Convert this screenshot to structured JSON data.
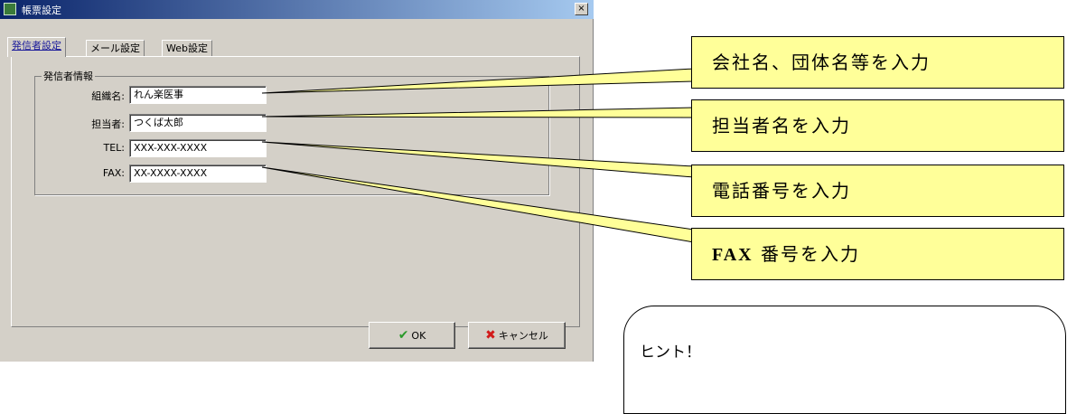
{
  "window": {
    "title": "帳票設定",
    "close_label": "×"
  },
  "tabs": [
    {
      "label": "発信者設定",
      "active": true
    },
    {
      "label": "メール設定",
      "active": false
    },
    {
      "label": "Web設定",
      "active": false
    }
  ],
  "group": {
    "title": "発信者情報"
  },
  "fields": [
    {
      "label": "組織名:",
      "value": "れん楽医事"
    },
    {
      "label": "担当者:",
      "value": "つくば太郎"
    },
    {
      "label": "TEL:",
      "value": "XXX-XXX-XXXX"
    },
    {
      "label": "FAX:",
      "value": "XX-XXXX-XXXX"
    }
  ],
  "buttons": {
    "ok_label": "OK",
    "cancel_label": "キャンセル"
  },
  "callouts": [
    {
      "text": "会社名、団体名等を入力"
    },
    {
      "text": "担当者名を入力"
    },
    {
      "text": "電話番号を入力"
    },
    {
      "text_prefix": "FAX",
      "text": " 番号を入力"
    }
  ],
  "hint": {
    "title": "ヒント！"
  },
  "colors": {
    "callout_fill": "#ffff99",
    "dialog_face": "#d4d0c8",
    "titlebar_start": "#0a246a"
  }
}
